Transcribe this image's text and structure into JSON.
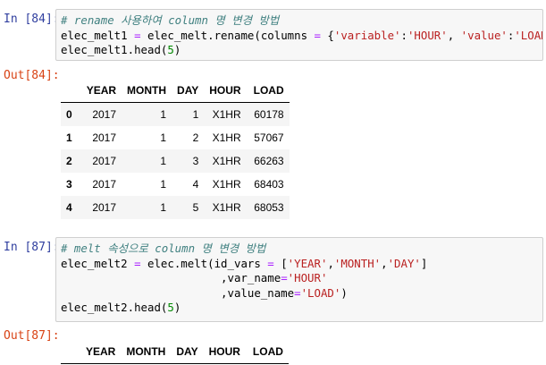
{
  "cell84": {
    "in_prompt": "In [84]:",
    "code": {
      "line1_comment": "# rename 사용하여 column 명 변경 방법",
      "line2_a": "elec_melt1 ",
      "line2_eq": "=",
      "line2_b": " elec_melt",
      "line2_c": ".rename(columns ",
      "line2_eq2": "=",
      "line2_d": " {",
      "line2_s1": "'variable'",
      "line2_e": ":",
      "line2_s2": "'HOUR'",
      "line2_f": ", ",
      "line2_s3": "'value'",
      "line2_g": ":",
      "line2_s4": "'LOAD'",
      "line2_h": "})",
      "line3_a": "elec_melt1",
      "line3_b": ".head(",
      "line3_num": "5",
      "line3_c": ")"
    },
    "out_prompt": "Out[84]:",
    "table": {
      "columns": [
        "",
        "YEAR",
        "MONTH",
        "DAY",
        "HOUR",
        "LOAD"
      ],
      "rows": [
        [
          "0",
          "2017",
          "1",
          "1",
          "X1HR",
          "60178"
        ],
        [
          "1",
          "2017",
          "1",
          "2",
          "X1HR",
          "57067"
        ],
        [
          "2",
          "2017",
          "1",
          "3",
          "X1HR",
          "66263"
        ],
        [
          "3",
          "2017",
          "1",
          "4",
          "X1HR",
          "68403"
        ],
        [
          "4",
          "2017",
          "1",
          "5",
          "X1HR",
          "68053"
        ]
      ]
    }
  },
  "cell87": {
    "in_prompt": "In [87]:",
    "code": {
      "line1_comment": "# melt 속성으로 column 명 변경 방법",
      "line2_a": "elec_melt2 ",
      "line2_eq": "=",
      "line2_b": " elec",
      "line2_c": ".melt(id_vars ",
      "line2_eq2": "=",
      "line2_d": " [",
      "line2_s1": "'YEAR'",
      "line2_e": ",",
      "line2_s2": "'MONTH'",
      "line2_f": ",",
      "line2_s3": "'DAY'",
      "line2_g": "]",
      "line3_pad": "                        ,var_name",
      "line3_eq": "=",
      "line3_s": "'HOUR'",
      "line4_pad": "                        ,value_name",
      "line4_eq": "=",
      "line4_s": "'LOAD'",
      "line4_end": ")",
      "line5_a": "elec_melt2",
      "line5_b": ".head(",
      "line5_num": "5",
      "line5_c": ")"
    },
    "out_prompt": "Out[87]:",
    "table": {
      "columns": [
        "",
        "YEAR",
        "MONTH",
        "DAY",
        "HOUR",
        "LOAD"
      ]
    }
  },
  "colors": {
    "in_prompt": "#303f9f",
    "out_prompt": "#d84315",
    "comment": "#408080",
    "string": "#ba2121",
    "number": "#008800",
    "operator": "#aa22ff",
    "code_bg": "#f7f7f7"
  }
}
